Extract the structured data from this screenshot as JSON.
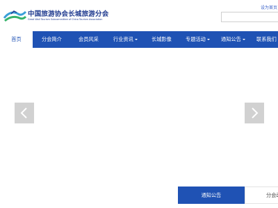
{
  "header": {
    "logo_icon": "great-wall-wave-logo",
    "title": "中国旅游协会长城旅游分会",
    "subtitle": "Great Wall Tourism Subcommittee of China Tourism Association",
    "set_home_label": "设为首页",
    "search_placeholder": ""
  },
  "nav": {
    "items": [
      {
        "label": "首页",
        "active": true
      },
      {
        "label": "分会简介"
      },
      {
        "label": "会员风采"
      },
      {
        "label": "行业资讯",
        "dropdown": true
      },
      {
        "label": "长城影像"
      },
      {
        "label": "专题活动",
        "dropdown": true
      },
      {
        "label": "通知公告",
        "dropdown": true
      },
      {
        "label": "联系我们",
        "dropdown": true
      }
    ]
  },
  "carousel": {
    "prev_icon": "chevron-left-icon",
    "next_icon": "chevron-right-icon"
  },
  "tabs": {
    "notice_label": "通知公告",
    "branch_label": "分会动"
  },
  "colors": {
    "primary": "#1f52b4",
    "brand_text": "#1f3a8f"
  }
}
